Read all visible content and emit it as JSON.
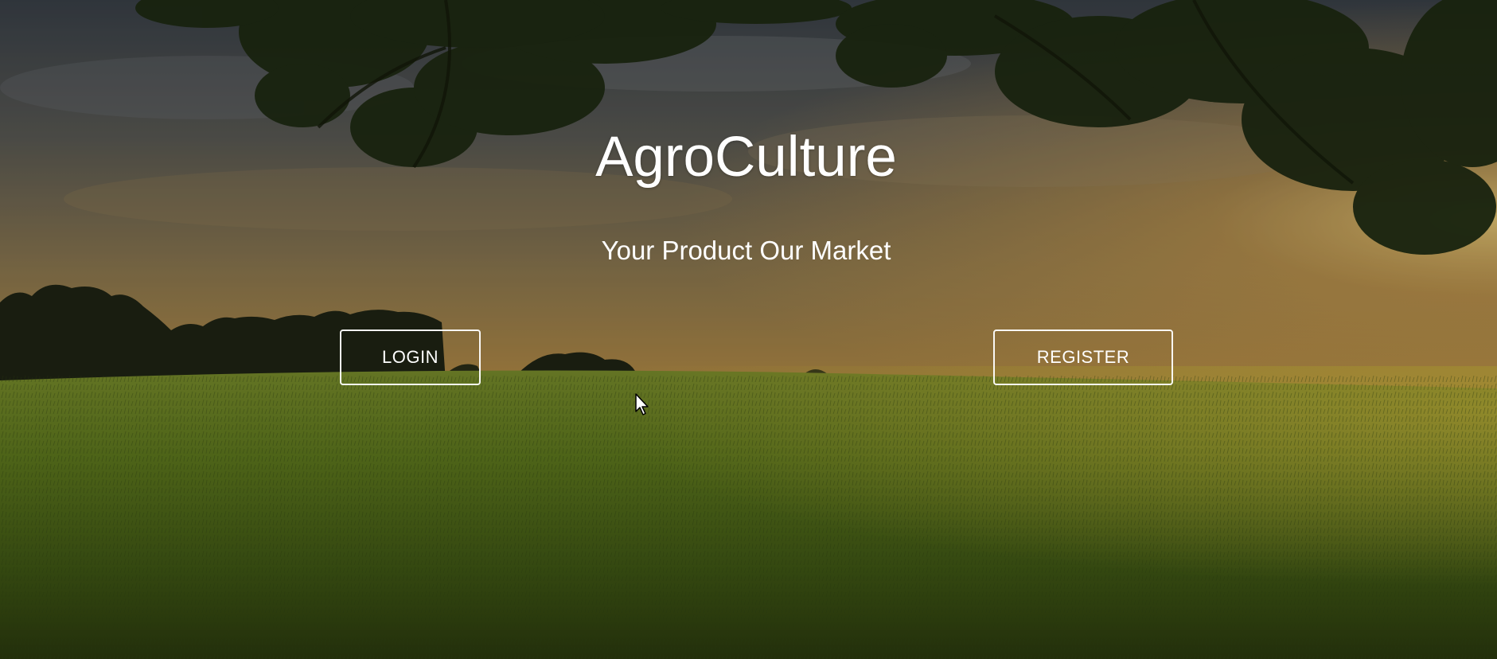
{
  "hero": {
    "title": "AgroCulture",
    "tagline": "Your Product Our Market"
  },
  "buttons": {
    "login_label": "LOGIN",
    "register_label": "REGISTER"
  },
  "colors": {
    "text": "#ffffff",
    "sky_top": "#3e4750",
    "sky_horizon": "#c99a45",
    "field": "#5c7a1c"
  }
}
